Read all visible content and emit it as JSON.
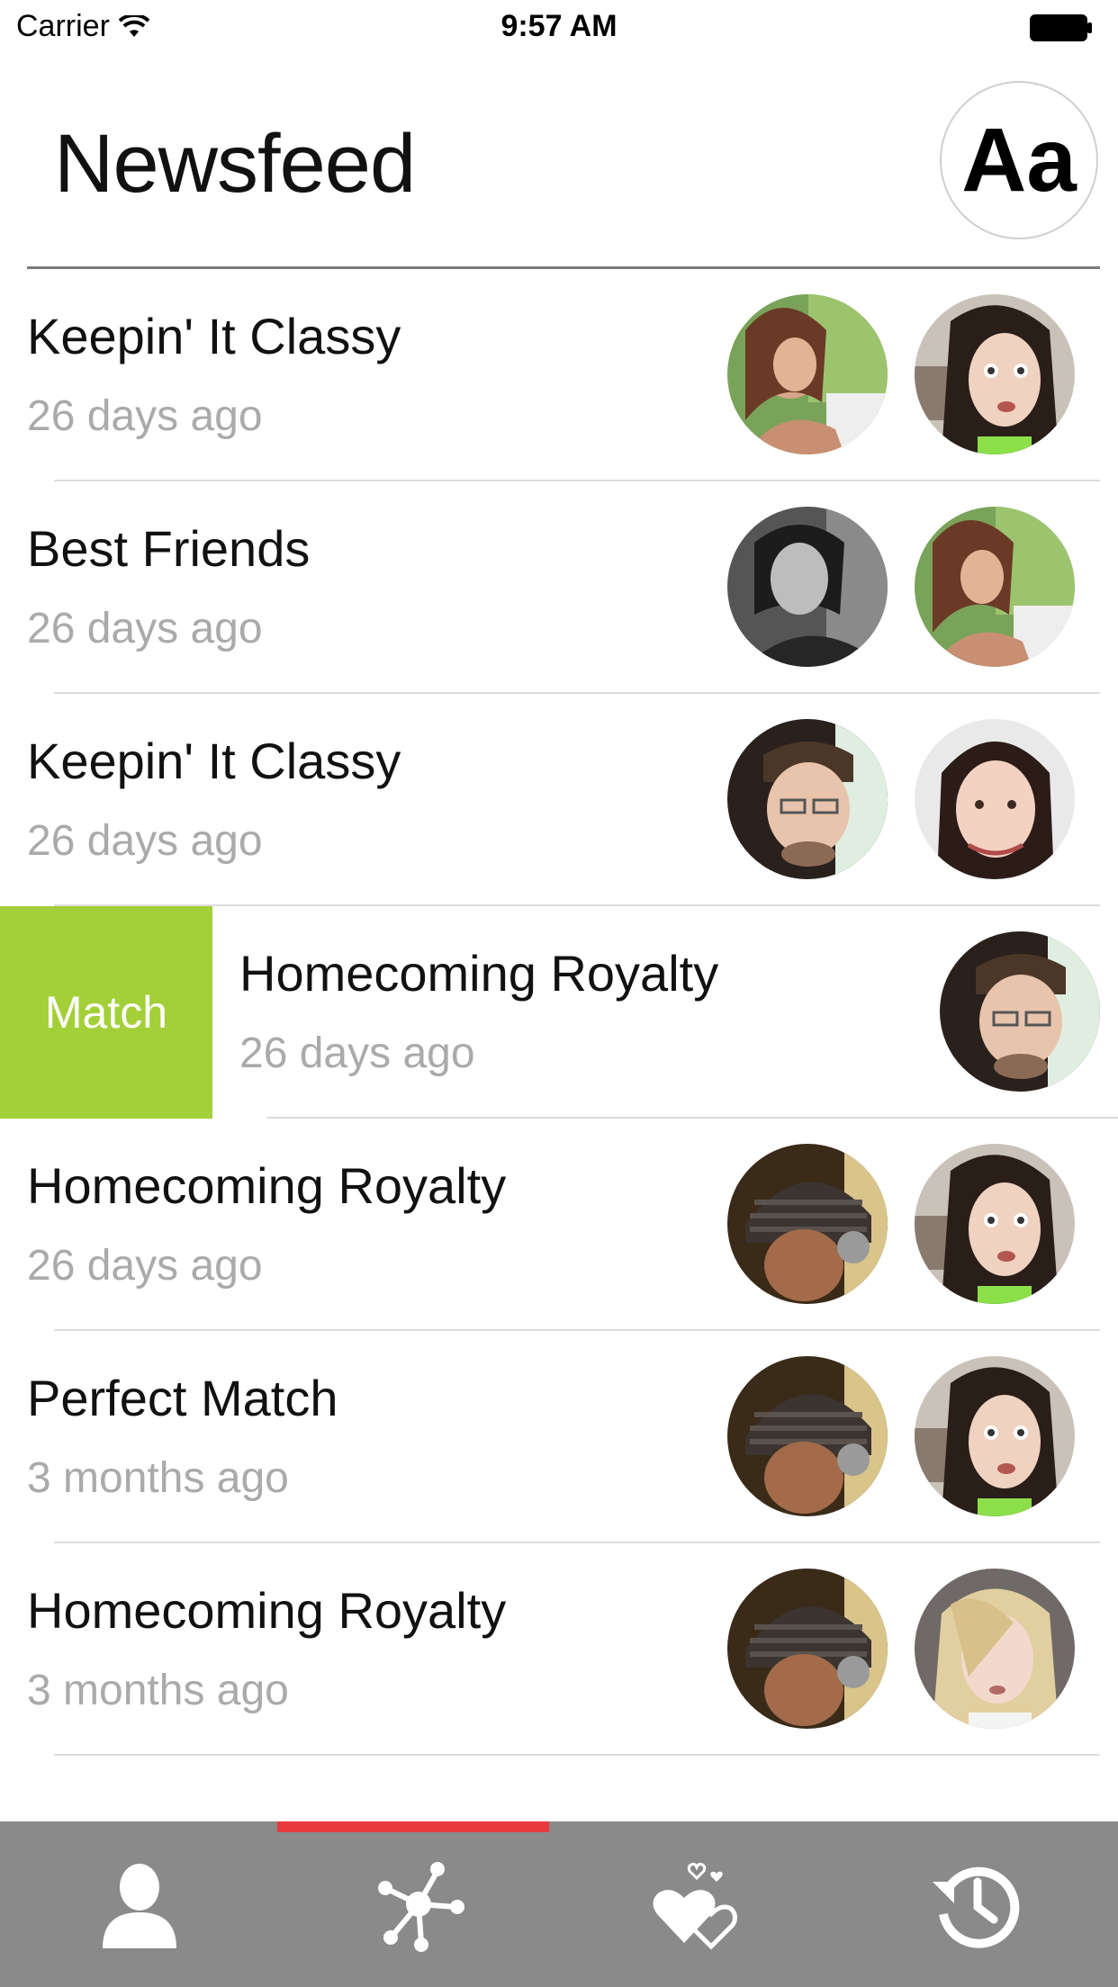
{
  "status_bar": {
    "carrier": "Carrier",
    "time": "9:57 AM"
  },
  "header": {
    "title": "Newsfeed",
    "font_button_label": "Aa"
  },
  "feed": [
    {
      "title": "Keepin' It Classy",
      "time": "26 days ago",
      "avatars": [
        "person-photo",
        "person-photo"
      ]
    },
    {
      "title": "Best Friends",
      "time": "26 days ago",
      "avatars": [
        "person-photo",
        "person-photo"
      ]
    },
    {
      "title": "Keepin' It Classy",
      "time": "26 days ago",
      "avatars": [
        "person-photo",
        "person-photo"
      ]
    },
    {
      "title": "Homecoming Royalty",
      "time": "26 days ago",
      "avatars": [
        "person-photo"
      ],
      "swipe_action": "Match"
    },
    {
      "title": "Homecoming Royalty",
      "time": "26 days ago",
      "avatars": [
        "person-photo",
        "person-photo"
      ]
    },
    {
      "title": "Perfect Match",
      "time": "3 months ago",
      "avatars": [
        "person-photo",
        "person-photo"
      ]
    },
    {
      "title": "Homecoming Royalty",
      "time": "3 months ago",
      "avatars": [
        "person-photo",
        "person-photo"
      ]
    }
  ],
  "tab_bar": {
    "tabs": [
      {
        "icon": "profile-icon",
        "selected": false
      },
      {
        "icon": "network-icon",
        "selected": true
      },
      {
        "icon": "hearts-icon",
        "selected": false
      },
      {
        "icon": "history-icon",
        "selected": false
      }
    ],
    "indicator_color": "#e8393f",
    "background": "#8a8a8a"
  },
  "colors": {
    "match_green": "#a3d038",
    "timestamp_gray": "#aaaaaa"
  }
}
